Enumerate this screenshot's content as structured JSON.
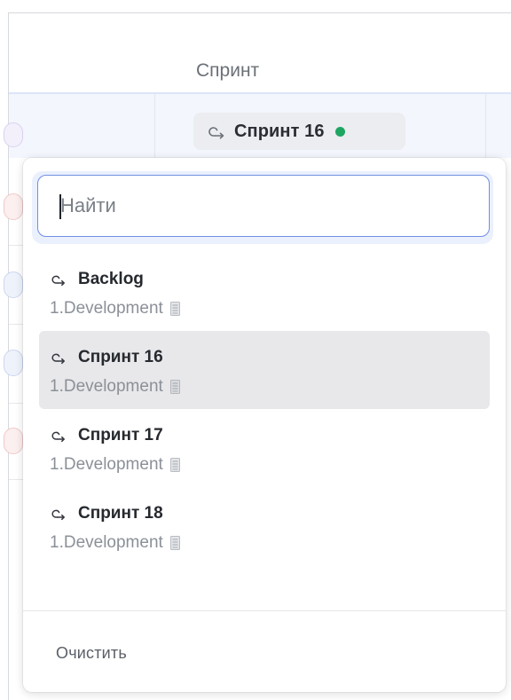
{
  "header": {
    "column_title": "Спринт"
  },
  "current_sprint": {
    "label": "Спринт 16",
    "status_color": "#1fa562"
  },
  "dropdown": {
    "search": {
      "value": "",
      "placeholder": "Найти"
    },
    "items": [
      {
        "title": "Backlog",
        "subtitle": "1.Development",
        "selected": false
      },
      {
        "title": "Спринт 16",
        "subtitle": "1.Development",
        "selected": true
      },
      {
        "title": "Спринт 17",
        "subtitle": "1.Development",
        "selected": false
      },
      {
        "title": "Спринт 18",
        "subtitle": "1.Development",
        "selected": false
      }
    ],
    "clear_label": "Очистить"
  },
  "icons": {
    "sprint": "sprint-cycle-icon",
    "project": "document-icon",
    "status": "status-dot"
  },
  "colors": {
    "accent": "#6f8fe0",
    "selected_bg": "#e8e8ea",
    "status_active": "#1fa562"
  }
}
